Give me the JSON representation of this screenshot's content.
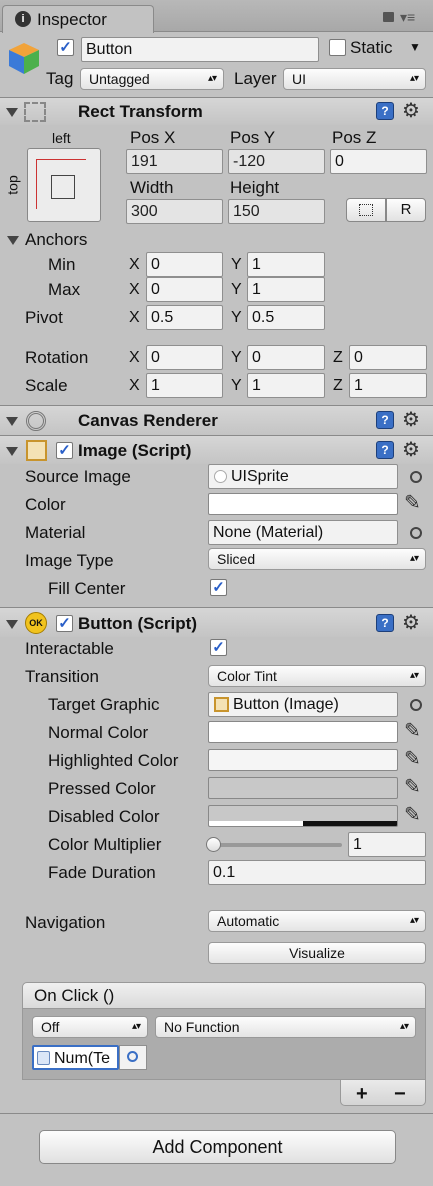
{
  "tab": {
    "label": "Inspector"
  },
  "object": {
    "name": "Button",
    "static_label": "Static",
    "tag_label": "Tag",
    "tag_value": "Untagged",
    "layer_label": "Layer",
    "layer_value": "UI"
  },
  "rect": {
    "title": "Rect Transform",
    "anchor_h": "left",
    "anchor_v": "top",
    "posx_label": "Pos X",
    "posy_label": "Pos Y",
    "posz_label": "Pos Z",
    "posx": "191",
    "posy": "-120",
    "posz": "0",
    "width_label": "Width",
    "height_label": "Height",
    "width": "300",
    "height": "150",
    "r_btn": "R",
    "anchors_label": "Anchors",
    "min_label": "Min",
    "max_label": "Max",
    "pivot_label": "Pivot",
    "min_x": "0",
    "min_y": "1",
    "max_x": "0",
    "max_y": "1",
    "pivot_x": "0.5",
    "pivot_y": "0.5",
    "rotation_label": "Rotation",
    "scale_label": "Scale",
    "rot_x": "0",
    "rot_y": "0",
    "rot_z": "0",
    "scale_x": "1",
    "scale_y": "1",
    "scale_z": "1",
    "x": "X",
    "y": "Y",
    "z": "Z"
  },
  "canvas": {
    "title": "Canvas Renderer"
  },
  "image": {
    "title": "Image (Script)",
    "source_label": "Source Image",
    "source_value": "UISprite",
    "color_label": "Color",
    "material_label": "Material",
    "material_value": "None (Material)",
    "type_label": "Image Type",
    "type_value": "Sliced",
    "fill_label": "Fill Center"
  },
  "button": {
    "title": "Button (Script)",
    "ok_badge": "OK",
    "interactable_label": "Interactable",
    "transition_label": "Transition",
    "transition_value": "Color Tint",
    "target_label": "Target Graphic",
    "target_value": "Button (Image)",
    "normal_label": "Normal Color",
    "highlighted_label": "Highlighted Color",
    "pressed_label": "Pressed Color",
    "disabled_label": "Disabled Color",
    "multiplier_label": "Color Multiplier",
    "multiplier_value": "1",
    "fade_label": "Fade Duration",
    "fade_value": "0.1",
    "navigation_label": "Navigation",
    "navigation_value": "Automatic",
    "visualize_label": "Visualize"
  },
  "onclick": {
    "title": "On Click ()",
    "runtime_value": "Off",
    "function_value": "No Function",
    "object_value": "Num(Te",
    "plus": "+",
    "minus": "−"
  },
  "add_component": "Add Component",
  "colors": {
    "accent": "#3a6fc5",
    "panel": "#c2c2c2",
    "field": "#f2f2f2"
  }
}
